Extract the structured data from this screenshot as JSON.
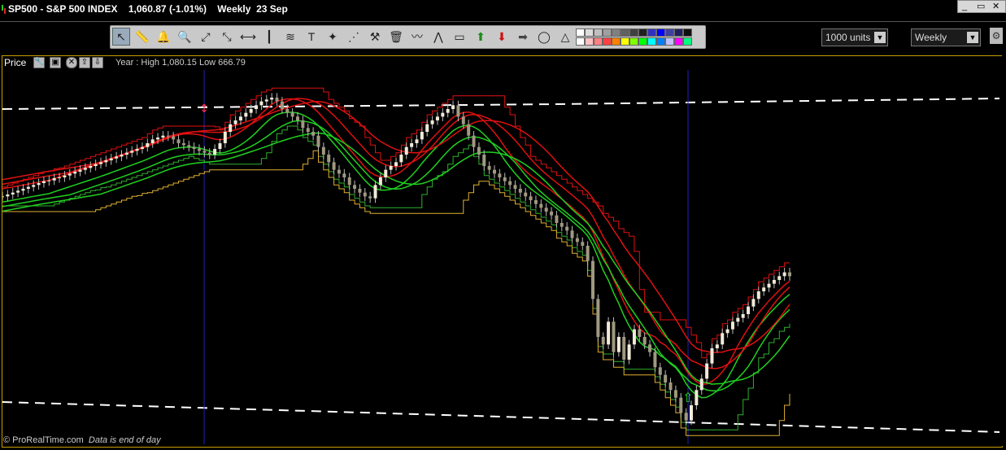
{
  "title": {
    "symbol": "SP500",
    "name": "S&P 500 INDEX",
    "last": "1,060.87",
    "change": "(-1.01%)",
    "period": "Weekly",
    "date": "23 Sep"
  },
  "window_controls": [
    "_",
    "▭",
    "✕"
  ],
  "toolbar": {
    "tools": [
      {
        "name": "pointer-tool",
        "glyph": "↖",
        "selected": true
      },
      {
        "name": "ruler-tool",
        "glyph": "📏"
      },
      {
        "name": "alert-bell-tool",
        "glyph": "🔔"
      },
      {
        "name": "zoom-tool",
        "glyph": "🔍"
      },
      {
        "name": "trendline-tool",
        "glyph": "⤢"
      },
      {
        "name": "extended-line-tool",
        "glyph": "⤡"
      },
      {
        "name": "horizontal-line-tool",
        "glyph": "⟷"
      },
      {
        "name": "vertical-line-tool",
        "glyph": "┃"
      },
      {
        "name": "channel-tool",
        "glyph": "≋"
      },
      {
        "name": "text-tool",
        "glyph": "T"
      },
      {
        "name": "fibonacci-tool",
        "glyph": "✦"
      },
      {
        "name": "fan-tool",
        "glyph": "⋰"
      },
      {
        "name": "tools-tool",
        "glyph": "⚒"
      },
      {
        "name": "delete-tool",
        "glyph": "🗑"
      },
      {
        "name": "wave-tool",
        "glyph": "〰"
      },
      {
        "name": "pattern-tool",
        "glyph": "⋀"
      },
      {
        "name": "rectangle-tool",
        "glyph": "▭"
      },
      {
        "name": "up-arrow-tool",
        "glyph": "⬆",
        "color": "#1a8a1a"
      },
      {
        "name": "down-arrow-tool",
        "glyph": "⬇",
        "color": "#d01010"
      },
      {
        "name": "right-arrow-tool",
        "glyph": "➡",
        "color": "#444"
      },
      {
        "name": "ellipse-tool",
        "glyph": "◯"
      },
      {
        "name": "triangle-tool",
        "glyph": "△"
      }
    ],
    "palette_top": [
      "#ffffff",
      "#dcdcdc",
      "#c0c0c0",
      "#a0a0a0",
      "#808080",
      "#606060",
      "#404040",
      "#202020",
      "#3030c0",
      "#0000ff",
      "#4040a0",
      "#202060",
      "#101010"
    ],
    "palette_bottom": [
      "#ffffff",
      "#ffc0c0",
      "#ff8080",
      "#ff4040",
      "#ff8000",
      "#ffff00",
      "#80ff00",
      "#00ff00",
      "#00ffff",
      "#0080ff",
      "#c0c0ff",
      "#ff00ff",
      "#00ff80"
    ]
  },
  "units_dropdown": {
    "value": "1000 units"
  },
  "period_dropdown": {
    "value": "Weekly"
  },
  "price_panel": {
    "label": "Price",
    "range": "Year : High 1,080.15 Low 666.79"
  },
  "footer": {
    "source": "© ProRealTime.com",
    "note": "Data is end of day"
  },
  "chart_data": {
    "type": "candlestick",
    "instrument": "SP500",
    "timeframe": "Weekly",
    "year_high": 1080.15,
    "year_low": 666.79,
    "last": 1060.87,
    "change_pct": -1.01,
    "colors": {
      "up_candle": "#f0ead8",
      "down_candle": "#a09880",
      "upper_bands": "#e01010",
      "lower_bands": "#20d020",
      "donchian_high": "#e01010",
      "donchian_low": "#30b030",
      "yellow_stop": "#e0b030",
      "dashed_lines": "#ffffff",
      "vertical_markers": "#2020c0"
    },
    "closes": [
      1270,
      1275,
      1280,
      1285,
      1290,
      1295,
      1300,
      1305,
      1310,
      1312,
      1318,
      1320,
      1325,
      1330,
      1335,
      1340,
      1345,
      1350,
      1355,
      1360,
      1365,
      1370,
      1375,
      1380,
      1385,
      1390,
      1395,
      1400,
      1410,
      1420,
      1425,
      1430,
      1428,
      1420,
      1410,
      1405,
      1400,
      1395,
      1390,
      1385,
      1380,
      1395,
      1410,
      1440,
      1460,
      1470,
      1480,
      1490,
      1500,
      1510,
      1520,
      1525,
      1530,
      1520,
      1500,
      1490,
      1480,
      1470,
      1450,
      1440,
      1430,
      1400,
      1380,
      1360,
      1340,
      1330,
      1320,
      1300,
      1290,
      1280,
      1270,
      1265,
      1300,
      1320,
      1340,
      1350,
      1360,
      1380,
      1400,
      1410,
      1420,
      1440,
      1460,
      1470,
      1480,
      1490,
      1500,
      1510,
      1480,
      1460,
      1430,
      1400,
      1380,
      1350,
      1340,
      1330,
      1320,
      1310,
      1300,
      1290,
      1280,
      1270,
      1260,
      1250,
      1240,
      1230,
      1220,
      1200,
      1190,
      1180,
      1160,
      1150,
      1140,
      1100,
      1000,
      900,
      880,
      940,
      860,
      900,
      840,
      880,
      920,
      900,
      880,
      860,
      820,
      800,
      780,
      760,
      740,
      700,
      680,
      720,
      760,
      790,
      830,
      870,
      880,
      910,
      920,
      940,
      950,
      960,
      980,
      1000,
      1020,
      1030,
      1040,
      1050,
      1060,
      1070,
      1060
    ]
  }
}
